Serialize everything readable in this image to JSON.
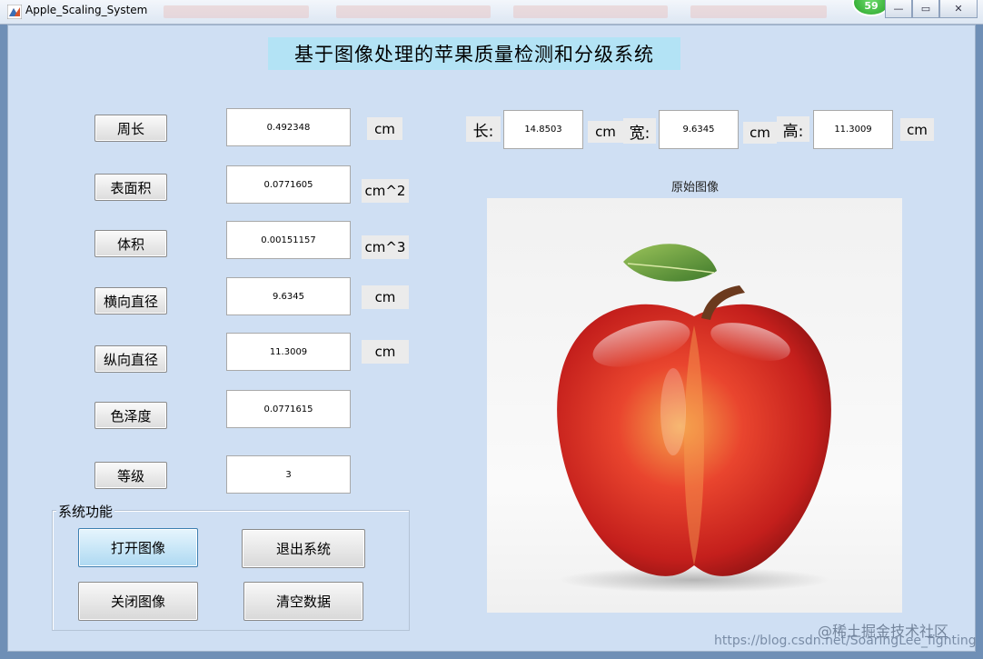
{
  "window": {
    "title": "Apple_Scaling_System",
    "badge": "59",
    "minimize_glyph": "—",
    "restore_glyph": "▭",
    "close_glyph": "✕"
  },
  "header": {
    "title": "基于图像处理的苹果质量检测和分级系统"
  },
  "measurements": [
    {
      "label": "周长",
      "value": "0.492348",
      "unit": "cm"
    },
    {
      "label": "表面积",
      "value": "0.0771605",
      "unit": "cm^2"
    },
    {
      "label": "体积",
      "value": "0.00151157",
      "unit": "cm^3"
    },
    {
      "label": "横向直径",
      "value": "9.6345",
      "unit": "cm"
    },
    {
      "label": "纵向直径",
      "value": "11.3009",
      "unit": "cm"
    },
    {
      "label": "色泽度",
      "value": "0.0771615",
      "unit": ""
    },
    {
      "label": "等级",
      "value": "3",
      "unit": ""
    }
  ],
  "dimensions": {
    "length": {
      "label": "长:",
      "value": "14.8503",
      "unit": "cm"
    },
    "width": {
      "label": "宽:",
      "value": "9.6345",
      "unit": "cm"
    },
    "height": {
      "label": "高:",
      "value": "11.3009",
      "unit": "cm"
    }
  },
  "panel": {
    "title": "系统功能",
    "open_image": "打开图像",
    "exit_system": "退出系统",
    "close_image": "关闭图像",
    "clear_data": "清空数据"
  },
  "image": {
    "caption": "原始图像"
  },
  "watermark": {
    "site": "@稀土掘金技术社区",
    "url": "https://blog.csdn.net/SoaringLee_fighting"
  },
  "icons": {
    "app": "matlab-icon",
    "preview": "apple-image"
  },
  "colors": {
    "figure_bg": "#cfdff3",
    "title_bg": "#b3e3f5",
    "active_button": "#aed9f2"
  }
}
